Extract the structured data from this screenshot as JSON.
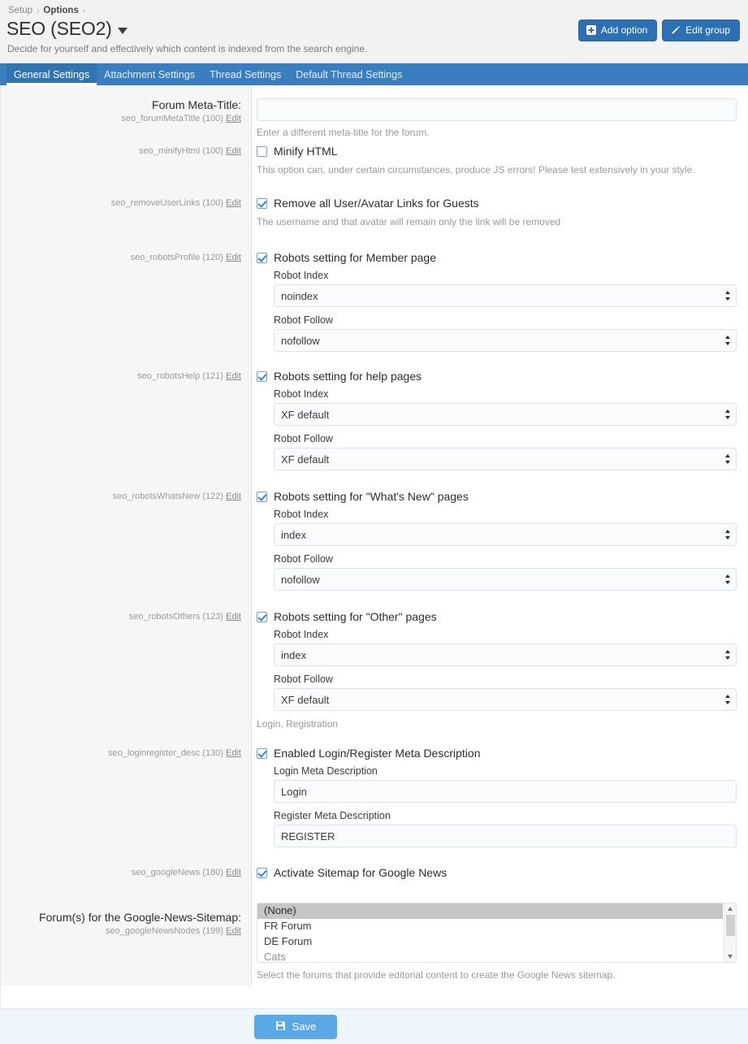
{
  "breadcrumb": {
    "items": [
      "Setup",
      "Options"
    ],
    "separator": "›"
  },
  "header": {
    "title": "SEO (SEO2)",
    "description": "Decide for yourself and effectively which content is indexed from the search engine.",
    "buttons": [
      {
        "label": "Add option",
        "icon": "plus-square-icon"
      },
      {
        "label": "Edit group",
        "icon": "pencil-icon"
      }
    ],
    "accent_color": "#2c6fb2"
  },
  "tabs": [
    {
      "label": "General Settings",
      "active": true
    },
    {
      "label": "Attachment Settings",
      "active": false
    },
    {
      "label": "Thread Settings",
      "active": false
    },
    {
      "label": "Default Thread Settings",
      "active": false
    }
  ],
  "tabbar_color": "#3a7ebf",
  "edit_link_label": "Edit",
  "fields": {
    "forum_meta_title": {
      "label": "Forum Meta-Title:",
      "key": "seo_forumMetaTitle (100)",
      "value": "",
      "hint": "Enter a different meta-title for the forum."
    },
    "minify_html": {
      "key": "seo_minifyHtml (100)",
      "label": "Minify HTML",
      "checked": false,
      "hint": "This option can, under certain circumstances, produce JS errors! Please test extensively in your style."
    },
    "remove_user_links": {
      "key": "seo_removeUserLinks (100)",
      "label": "Remove all User/Avatar Links for Guests",
      "checked": true,
      "hint": "The username and that avatar will remain only the link will be removed"
    },
    "robots_profile": {
      "key": "seo_robotsProfile (120)",
      "label": "Robots setting for Member page",
      "checked": true,
      "index_label": "Robot Index",
      "index_value": "noindex",
      "follow_label": "Robot Follow",
      "follow_value": "nofollow"
    },
    "robots_help": {
      "key": "seo_robotsHelp (121)",
      "label": "Robots setting for help pages",
      "checked": true,
      "index_label": "Robot Index",
      "index_value": "XF default",
      "follow_label": "Robot Follow",
      "follow_value": "XF default"
    },
    "robots_whatsnew": {
      "key": "seo_robotsWhatsNew (122)",
      "label": "Robots setting for \"What's New\" pages",
      "checked": true,
      "index_label": "Robot Index",
      "index_value": "index",
      "follow_label": "Robot Follow",
      "follow_value": "nofollow"
    },
    "robots_others": {
      "key": "seo_robotsOthers (123)",
      "label": "Robots setting for \"Other\" pages",
      "checked": true,
      "index_label": "Robot Index",
      "index_value": "index",
      "follow_label": "Robot Follow",
      "follow_value": "XF default",
      "hint": "Login, Registration"
    },
    "loginregister_desc": {
      "key": "seo_loginregister_desc (130)",
      "label": "Enabled Login/Register Meta Description",
      "checked": true,
      "login_label": "Login Meta Description",
      "login_value": "Login",
      "register_label": "Register Meta Description",
      "register_value": "REGISTER"
    },
    "google_news": {
      "key": "seo_googleNews (180)",
      "label": "Activate Sitemap for Google News",
      "checked": true
    },
    "google_news_nodes": {
      "label": "Forum(s) for the Google-News-Sitemap:",
      "key": "seo_googleNewsNodes (199)",
      "options": [
        {
          "label": "(None)",
          "selected": true,
          "dim": false
        },
        {
          "label": "FR Forum",
          "selected": false,
          "dim": false
        },
        {
          "label": "DE Forum",
          "selected": false,
          "dim": false
        },
        {
          "label": "Cats",
          "selected": false,
          "dim": true
        }
      ],
      "hint": "Select the forums that provide editorial content to create the Google News sitemap."
    }
  },
  "footer": {
    "save_label": "Save",
    "save_icon": "floppy-disk-icon",
    "save_color": "#5aa9e6"
  }
}
